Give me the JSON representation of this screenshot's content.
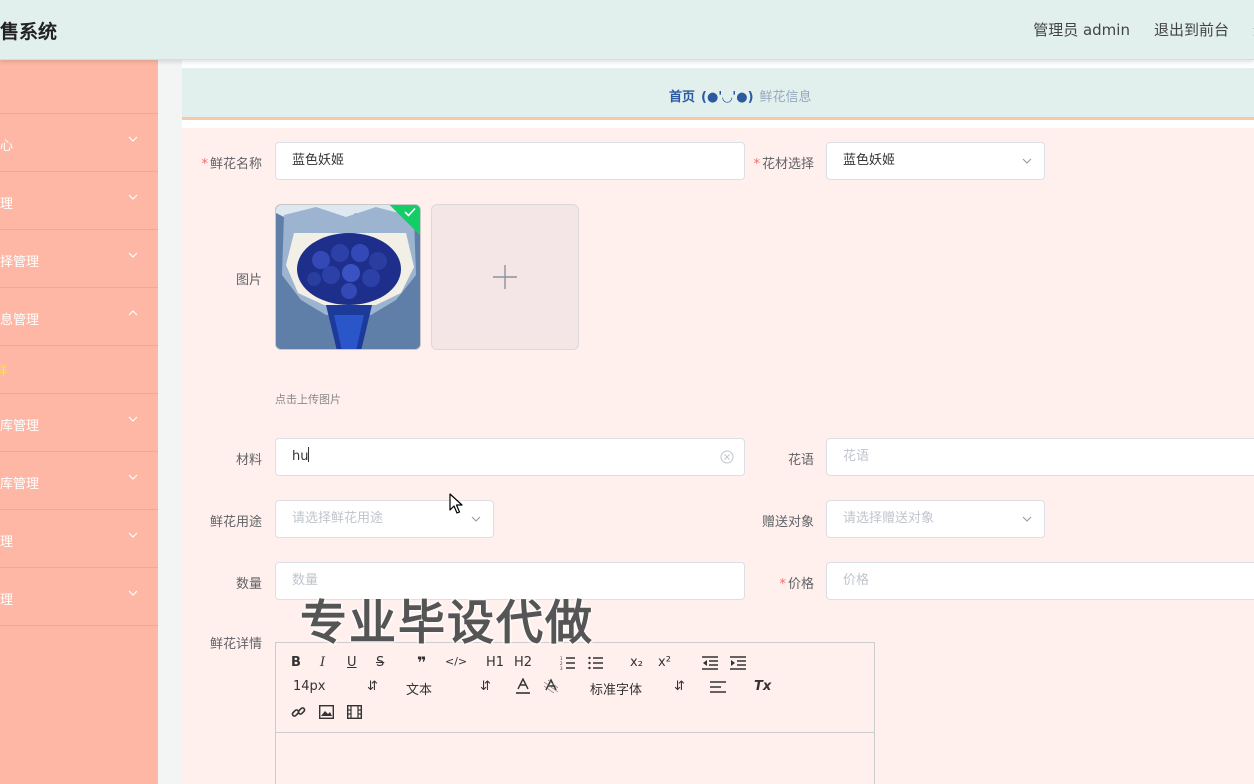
{
  "header": {
    "title": "售系统",
    "admin_label": "管理员 admin",
    "exit_front": "退出到前台",
    "exit": "退"
  },
  "sidebar": {
    "items": [
      {
        "label": "心",
        "icon": "chevron-down-icon"
      },
      {
        "label": "理",
        "icon": "chevron-down-icon"
      },
      {
        "label": "择管理",
        "icon": "chevron-down-icon"
      },
      {
        "label": "息管理",
        "icon": "chevron-up-icon"
      },
      {
        "label": "库管理",
        "icon": "chevron-down-icon"
      },
      {
        "label": "库管理",
        "icon": "chevron-down-icon"
      },
      {
        "label": "理",
        "icon": "chevron-down-icon"
      },
      {
        "label": "理",
        "icon": "chevron-down-icon"
      }
    ],
    "active_sub": "鲜"
  },
  "breadcrumb": {
    "home": "首页",
    "separator": "(●'◡'●)",
    "current": "鲜花信息"
  },
  "form": {
    "name_label": "鲜花名称",
    "name_value": "蓝色妖姬",
    "material_select_label": "花材选择",
    "material_select_value": "蓝色妖姬",
    "image_label": "图片",
    "upload_hint": "点击上传图片",
    "material_label": "材料",
    "material_value": "hu",
    "flower_lang_label": "花语",
    "flower_lang_placeholder": "花语",
    "usage_label": "鲜花用途",
    "usage_placeholder": "请选择鲜花用途",
    "recipient_label": "赠送对象",
    "recipient_placeholder": "请选择赠送对象",
    "quantity_label": "数量",
    "quantity_placeholder": "数量",
    "price_label": "价格",
    "price_placeholder": "价格",
    "detail_label": "鲜花详情"
  },
  "editor": {
    "bold": "B",
    "italic": "I",
    "underline": "U",
    "strike": "S",
    "quote": "❞",
    "code": "</>",
    "h1": "H1",
    "h2": "H2",
    "subscript": "x₂",
    "superscript": "x²",
    "font_size": "14px",
    "text_type": "文本",
    "font_family": "标准字体",
    "clear_format": "Tx"
  },
  "watermark": "专业毕设代做",
  "colors": {
    "header_bg": "#e1f0ec",
    "sidebar_bg": "#fdb7a4",
    "form_bg": "#fff0ed",
    "required": "#f56c6c",
    "accent_blue": "#2c5aa0",
    "success_green": "#13ce66"
  }
}
